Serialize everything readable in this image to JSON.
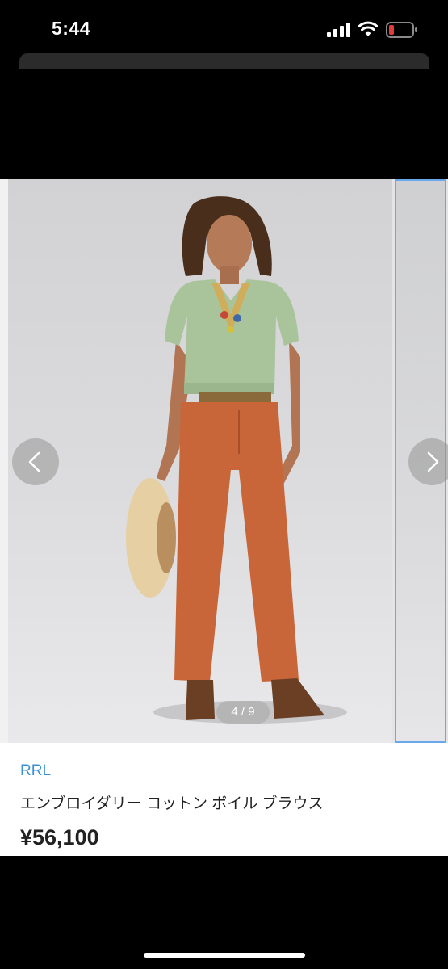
{
  "status_bar": {
    "time": "5:44",
    "icons": [
      "signal-icon",
      "wifi-icon",
      "battery-low-icon"
    ],
    "battery_color": "#e23b3b"
  },
  "gallery": {
    "counter": "4 / 9",
    "prev_icon": "chevron-left-icon",
    "next_icon": "chevron-right-icon",
    "current_index": 4,
    "total": 9
  },
  "product": {
    "brand": "RRL",
    "name": "エンブロイダリー コットン ボイル ブラウス",
    "price": "¥56,100"
  },
  "colors": {
    "brand_link": "#3a8fd1",
    "selection_border": "#6aa8ee"
  }
}
